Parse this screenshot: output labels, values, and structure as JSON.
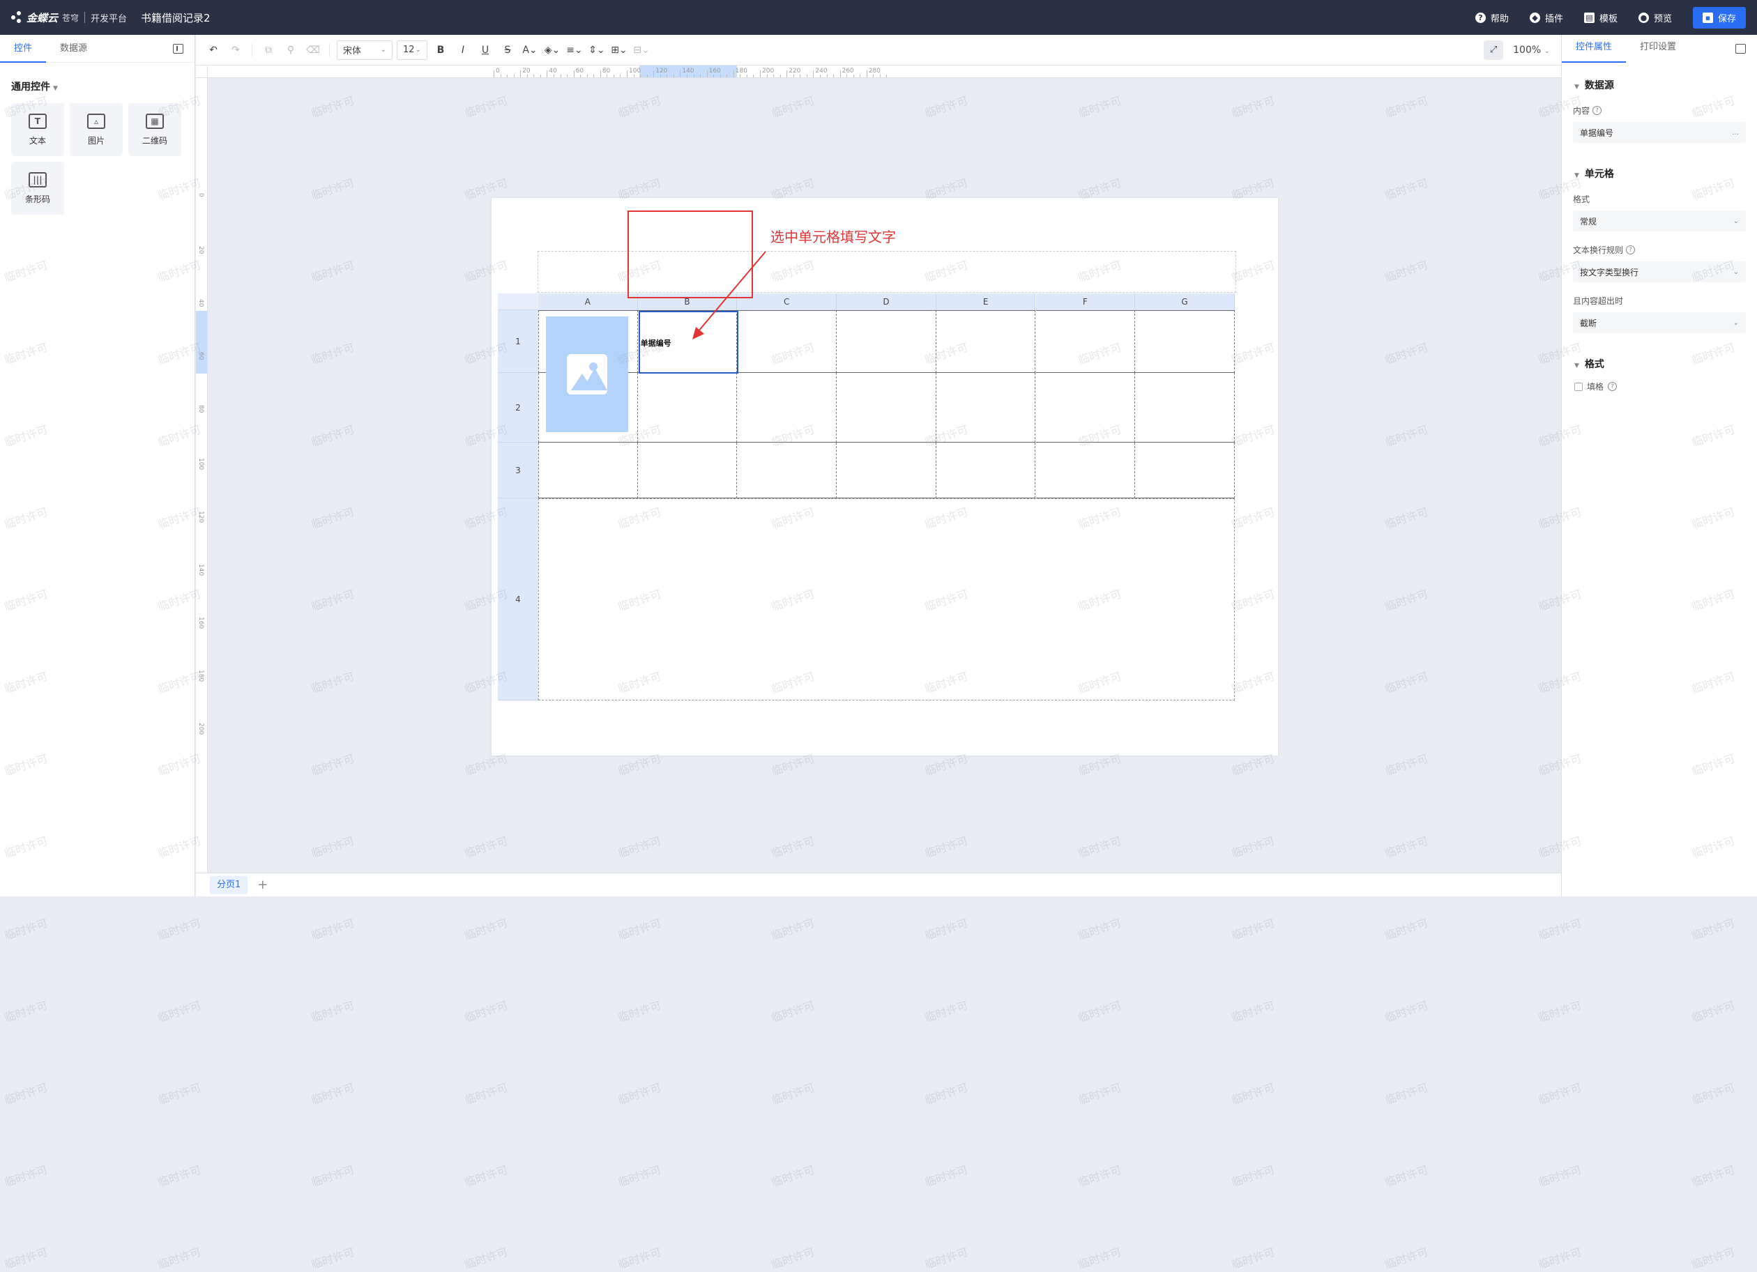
{
  "topbar": {
    "brand": "金蝶云",
    "brand_sub": "苍穹",
    "platform": "开发平台",
    "doc_title": "书籍借阅记录2",
    "help": "帮助",
    "plugin": "插件",
    "template": "模板",
    "preview": "预览",
    "save": "保存"
  },
  "left_panel": {
    "tabs": [
      "控件",
      "数据源"
    ],
    "section_title": "通用控件",
    "controls": [
      {
        "label": "文本",
        "icon": "text-icon"
      },
      {
        "label": "图片",
        "icon": "image-icon"
      },
      {
        "label": "二维码",
        "icon": "qrcode-icon"
      },
      {
        "label": "条形码",
        "icon": "barcode-icon"
      }
    ]
  },
  "toolbar": {
    "font_family": "宋体",
    "font_size": "12",
    "zoom": "100%"
  },
  "ruler": {
    "h_labels": [
      "0",
      "20",
      "40",
      "60",
      "80",
      "100",
      "120",
      "140",
      "160",
      "180",
      "200",
      "220",
      "240",
      "260",
      "280"
    ],
    "v_labels": [
      "0",
      "20",
      "40",
      "60",
      "80",
      "100",
      "120",
      "140",
      "160",
      "180",
      "200"
    ]
  },
  "sheet": {
    "columns": [
      "A",
      "B",
      "C",
      "D",
      "E",
      "F",
      "G"
    ],
    "rows": [
      "1",
      "2",
      "3",
      "4"
    ],
    "selected_cell_text": "单据编号"
  },
  "annotation": "选中单元格填写文字",
  "pages": {
    "current": "分页1",
    "add": "+"
  },
  "right_panel": {
    "tabs": [
      "控件属性",
      "打印设置"
    ],
    "datasource_title": "数据源",
    "content_label": "内容",
    "content_value": "单据编号",
    "cell_title": "单元格",
    "format_label": "格式",
    "format_value": "常规",
    "wrap_label": "文本换行规则",
    "wrap_value": "按文字类型换行",
    "overflow_label": "且内容超出时",
    "overflow_value": "截断",
    "format2_title": "格式",
    "fill_label": "填格"
  },
  "watermark": "临时许可"
}
